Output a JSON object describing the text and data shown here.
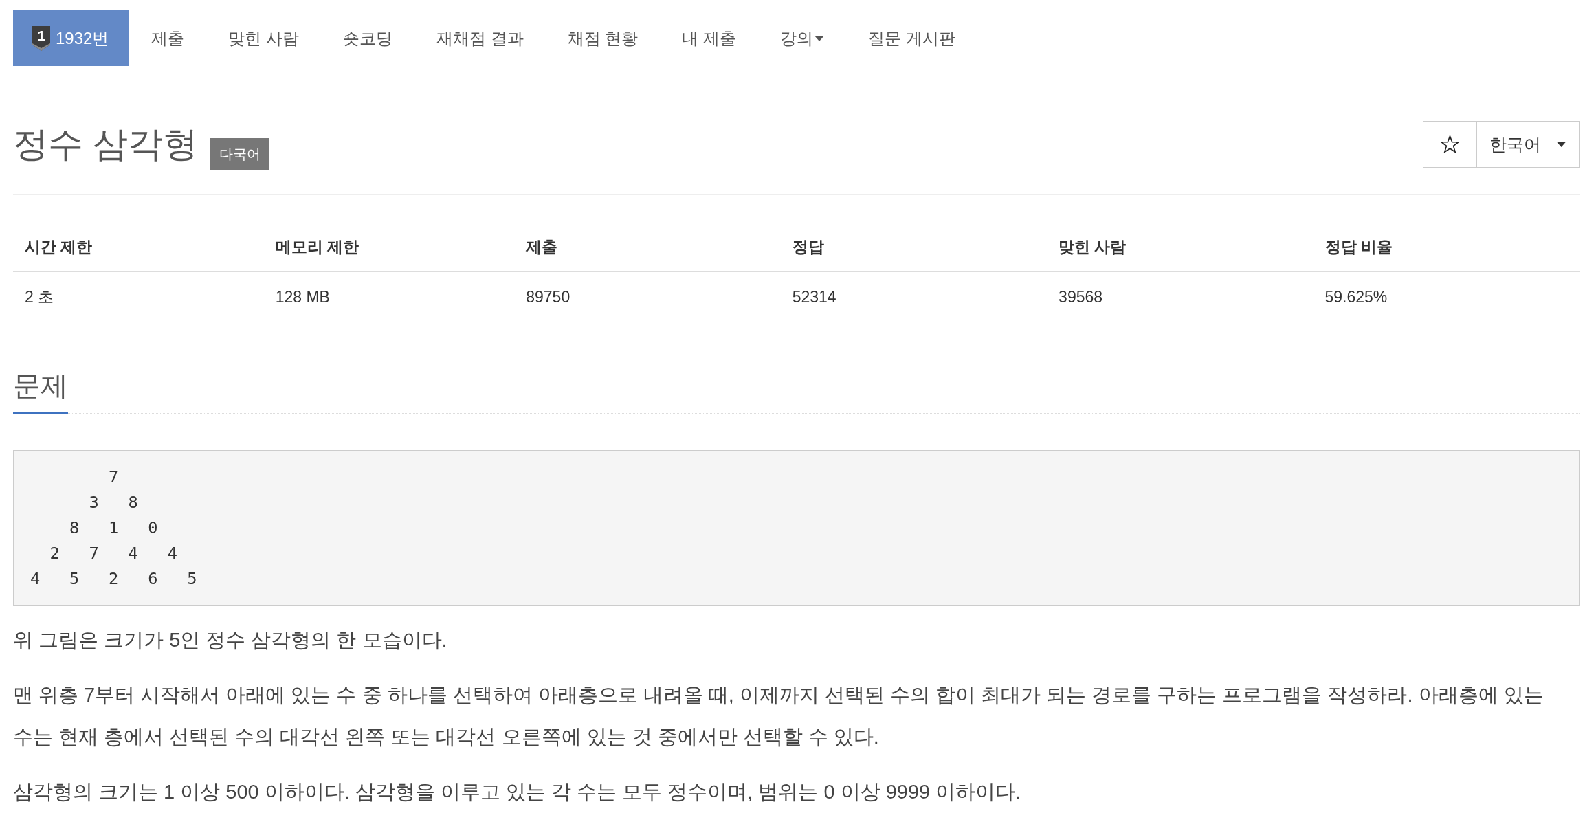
{
  "nav": {
    "tabs": [
      {
        "label": "1932번",
        "badge": "1",
        "selected": true,
        "dropdown": false
      },
      {
        "label": "제출",
        "selected": false,
        "dropdown": false
      },
      {
        "label": "맞힌 사람",
        "selected": false,
        "dropdown": false
      },
      {
        "label": "숏코딩",
        "selected": false,
        "dropdown": false
      },
      {
        "label": "재채점 결과",
        "selected": false,
        "dropdown": false
      },
      {
        "label": "채점 현황",
        "selected": false,
        "dropdown": false
      },
      {
        "label": "내 제출",
        "selected": false,
        "dropdown": false
      },
      {
        "label": "강의",
        "selected": false,
        "dropdown": true
      },
      {
        "label": "질문 게시판",
        "selected": false,
        "dropdown": false
      }
    ]
  },
  "problem": {
    "title": "정수 삼각형",
    "tag": "다국어",
    "starred": false,
    "language": "한국어"
  },
  "info_table": {
    "columns": [
      "시간 제한",
      "메모리 제한",
      "제출",
      "정답",
      "맞힌 사람",
      "정답 비율"
    ],
    "rows": [
      [
        "2 초",
        "128 MB",
        "89750",
        "52314",
        "39568",
        "59.625%"
      ]
    ]
  },
  "problem_section": {
    "heading": "문제",
    "code_lines": [
      "        7",
      "      3   8",
      "    8   1   0",
      "  2   7   4   4",
      "4   5   2   6   5"
    ],
    "paragraphs": [
      "위 그림은 크기가 5인 정수 삼각형의 한 모습이다.",
      "맨 위층 7부터 시작해서 아래에 있는 수 중 하나를 선택하여 아래층으로 내려올 때, 이제까지 선택된 수의 합이 최대가 되는 경로를 구하는 프로그램을 작성하라. 아래층에 있는 수는 현재 층에서 선택된 수의 대각선 왼쪽 또는 대각선 오른쪽에 있는 것 중에서만 선택할 수 있다.",
      "삼각형의 크기는 1 이상 500 이하이다. 삼각형을 이루고 있는 각 수는 모두 정수이며, 범위는 0 이상 9999 이하이다."
    ]
  }
}
